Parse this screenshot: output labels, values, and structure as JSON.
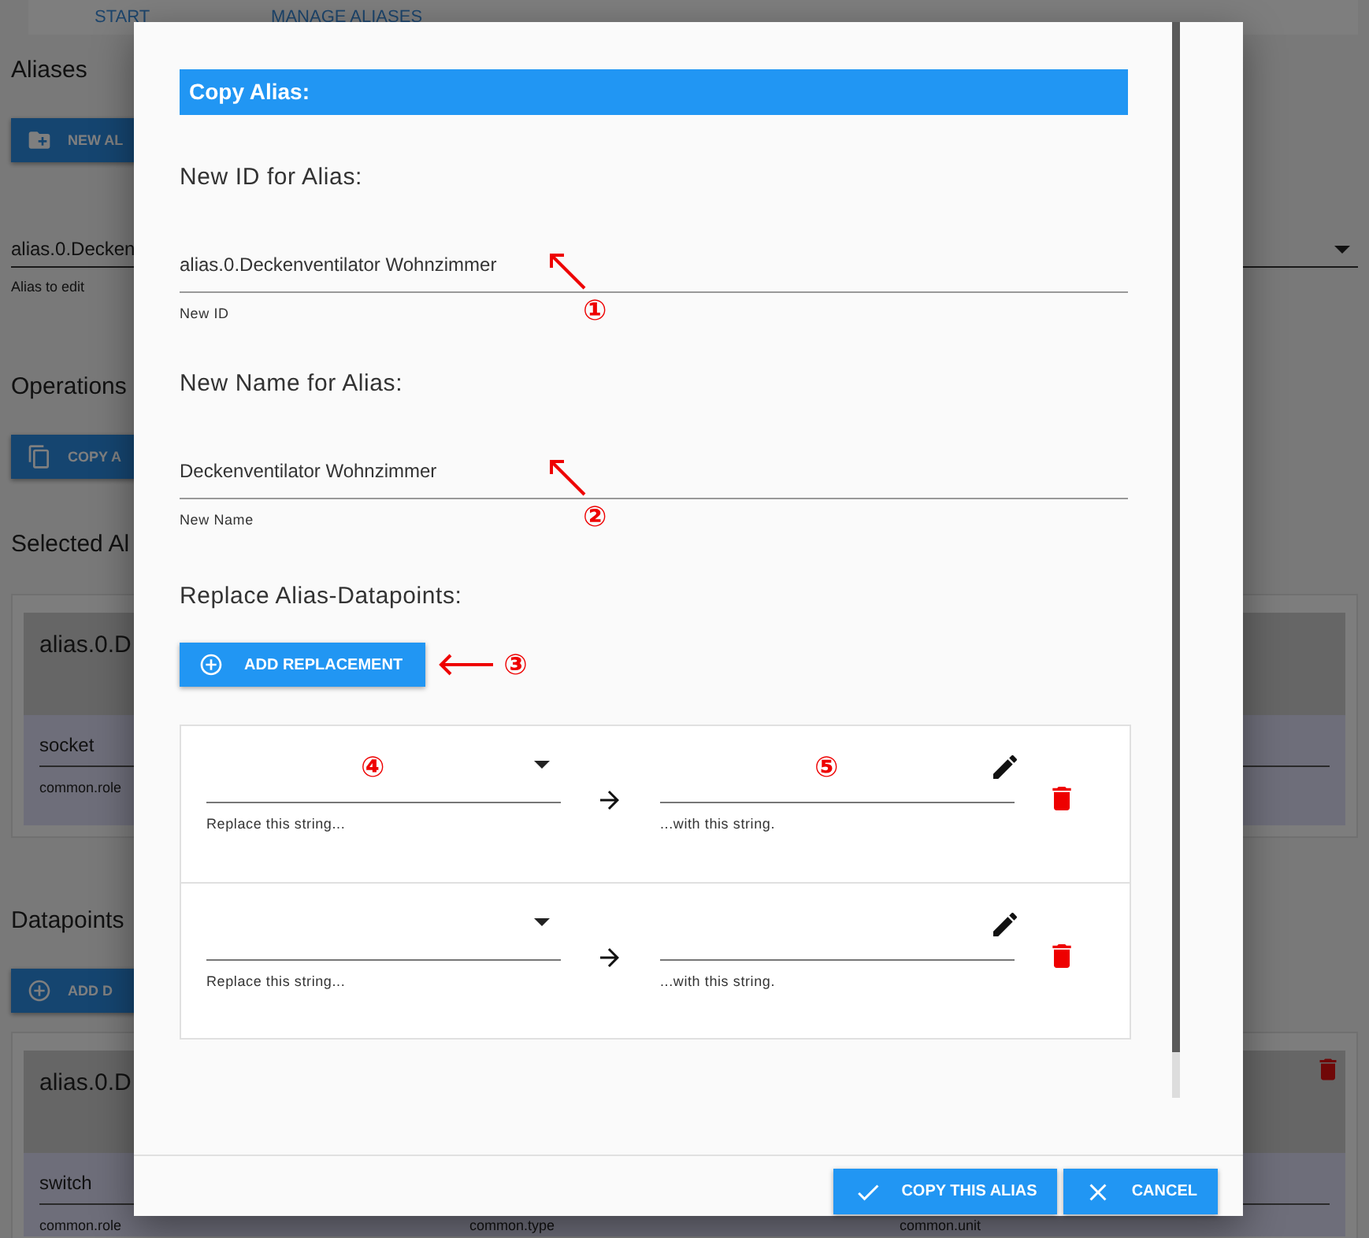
{
  "background": {
    "tabs": [
      "START",
      "MANAGE ALIASES"
    ],
    "aliases_heading": "Aliases",
    "new_alias_button": "NEW AL",
    "alias_select": {
      "value": "alias.0.Decken",
      "helper": "Alias to edit"
    },
    "operations_heading": "Operations",
    "copy_alias_button": "COPY A",
    "selected_alias_heading": "Selected Al",
    "selected_alias_card": {
      "title": "alias.0.D",
      "value": "socket",
      "fields": [
        "common.role"
      ]
    },
    "datapoints_heading": "Datapoints",
    "add_datapoint_button": "ADD D",
    "datapoint_card": {
      "title": "alias.0.D",
      "value": "switch",
      "fields": [
        "common.role",
        "common.type",
        "common.unit"
      ]
    }
  },
  "dialog": {
    "title": "Copy Alias:",
    "new_id": {
      "heading": "New ID for Alias:",
      "value": "alias.0.Deckenventilator Wohnzimmer",
      "helper": "New ID",
      "annotation": "①"
    },
    "new_name": {
      "heading": "New Name for Alias:",
      "value": "Deckenventilator Wohnzimmer",
      "helper": "New Name",
      "annotation": "②"
    },
    "replace_heading": "Replace Alias-Datapoints:",
    "add_replacement_button": {
      "label": "ADD REPLACEMENT",
      "annotation": "③"
    },
    "replacements": [
      {
        "from_helper": "Replace this string...",
        "to_helper": "...with this string.",
        "from_annotation": "④",
        "to_annotation": "⑤"
      },
      {
        "from_helper": "Replace this string...",
        "to_helper": "...with this string."
      }
    ],
    "buttons": [
      {
        "label": "COPY THIS ALIAS",
        "kind": "confirm"
      },
      {
        "label": "CANCEL",
        "kind": "cancel"
      }
    ]
  }
}
